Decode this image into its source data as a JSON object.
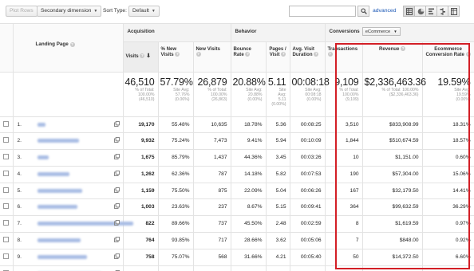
{
  "toolbar": {
    "plot_rows": "Plot Rows",
    "secondary_dimension": "Secondary dimension",
    "sort_type_label": "Sort Type:",
    "sort_type_value": "Default",
    "search_placeholder": "",
    "advanced": "advanced",
    "view_icons": [
      "data-table-icon",
      "pie-chart-icon",
      "performance-bar-icon",
      "comparison-icon",
      "pivot-icon"
    ]
  },
  "groups": {
    "acquisition": "Acquisition",
    "behavior": "Behavior",
    "conversions": "Conversions",
    "conversion_select": "eCommerce"
  },
  "columns": {
    "landing_page": "Landing Page",
    "visits": "Visits",
    "new_visits_pct": "% New Visits",
    "new_visits": "New Visits",
    "bounce_rate": "Bounce Rate",
    "pages_visit": "Pages / Visit",
    "avg_visit_duration": "Avg. Visit Duration",
    "transactions": "Transactions",
    "revenue": "Revenue",
    "ecommerce_conversion_rate": "Ecommerce Conversion Rate"
  },
  "totals": {
    "visits": {
      "value": "46,510",
      "sub1": "% of Total:",
      "sub2": "100.00%",
      "sub3": "(46,510)"
    },
    "new_visits_pct": {
      "value": "57.79%",
      "sub1": "Site Avg:",
      "sub2": "57.76%",
      "sub3": "(0.06%)"
    },
    "new_visits": {
      "value": "26,879",
      "sub1": "% of Total:",
      "sub2": "100.00%",
      "sub3": "(26,863)"
    },
    "bounce_rate": {
      "value": "20.88%",
      "sub1": "Site Avg:",
      "sub2": "20.88%",
      "sub3": "(0.00%)"
    },
    "pages_visit": {
      "value": "5.11",
      "sub1": "Site",
      "sub2": "Avg:",
      "sub3": "5.11",
      "sub4": "(0.00%)"
    },
    "avg_visit_duration": {
      "value": "00:08:18",
      "sub1": "Site Avg:",
      "sub2": "00:08:18",
      "sub3": "(0.00%)"
    },
    "transactions": {
      "value": "9,109",
      "sub1": "% of Total:",
      "sub2": "100.00%",
      "sub3": "(9,109)"
    },
    "revenue": {
      "value": "$2,336,463.36",
      "sub1": "% of Total: 100.00%",
      "sub2": "($2,336,463.36)"
    },
    "ecommerce_conversion_rate": {
      "value": "19.59%",
      "sub1": "Site Avg:",
      "sub2": "19.59%",
      "sub3": "(0.00%)"
    }
  },
  "rows": [
    {
      "num": "1.",
      "visits": "19,170",
      "new_pct": "55.48%",
      "new_visits": "10,635",
      "bounce": "18.78%",
      "pages": "5.36",
      "duration": "00:08:25",
      "transactions": "3,510",
      "revenue": "$833,908.99",
      "conv": "18.31%"
    },
    {
      "num": "2.",
      "visits": "9,932",
      "new_pct": "75.24%",
      "new_visits": "7,473",
      "bounce": "9.41%",
      "pages": "5.94",
      "duration": "00:10:09",
      "transactions": "1,844",
      "revenue": "$510,674.59",
      "conv": "18.57%"
    },
    {
      "num": "3.",
      "visits": "1,675",
      "new_pct": "85.79%",
      "new_visits": "1,437",
      "bounce": "44.36%",
      "pages": "3.45",
      "duration": "00:03:26",
      "transactions": "10",
      "revenue": "$1,151.00",
      "conv": "0.60%"
    },
    {
      "num": "4.",
      "visits": "1,262",
      "new_pct": "62.36%",
      "new_visits": "787",
      "bounce": "14.18%",
      "pages": "5.82",
      "duration": "00:07:53",
      "transactions": "190",
      "revenue": "$57,304.00",
      "conv": "15.06%"
    },
    {
      "num": "5.",
      "visits": "1,159",
      "new_pct": "75.50%",
      "new_visits": "875",
      "bounce": "22.09%",
      "pages": "5.04",
      "duration": "00:06:26",
      "transactions": "167",
      "revenue": "$32,179.50",
      "conv": "14.41%"
    },
    {
      "num": "6.",
      "visits": "1,003",
      "new_pct": "23.63%",
      "new_visits": "237",
      "bounce": "8.67%",
      "pages": "5.15",
      "duration": "00:09:41",
      "transactions": "364",
      "revenue": "$99,632.59",
      "conv": "36.29%"
    },
    {
      "num": "7.",
      "visits": "822",
      "new_pct": "89.66%",
      "new_visits": "737",
      "bounce": "45.50%",
      "pages": "2.48",
      "duration": "00:02:59",
      "transactions": "8",
      "revenue": "$1,619.59",
      "conv": "0.97%"
    },
    {
      "num": "8.",
      "visits": "764",
      "new_pct": "93.85%",
      "new_visits": "717",
      "bounce": "28.66%",
      "pages": "3.62",
      "duration": "00:05:06",
      "transactions": "7",
      "revenue": "$848.00",
      "conv": "0.92%"
    },
    {
      "num": "9.",
      "visits": "758",
      "new_pct": "75.07%",
      "new_visits": "568",
      "bounce": "31.66%",
      "pages": "4.21",
      "duration": "00:05:40",
      "transactions": "50",
      "revenue": "$14,372.50",
      "conv": "6.60%"
    },
    {
      "num": "10.",
      "visits": "711",
      "new_pct": "8.72%",
      "new_visits": "62",
      "bounce": "0.84%",
      "pages": "5.19",
      "duration": "00:08:28",
      "transactions": "709",
      "revenue": "$193,761.29",
      "conv": "99.72%"
    }
  ],
  "colors": {
    "highlight_border": "#d31f26",
    "link": "#1a57b5",
    "header_bg": "#f3f3f3"
  }
}
